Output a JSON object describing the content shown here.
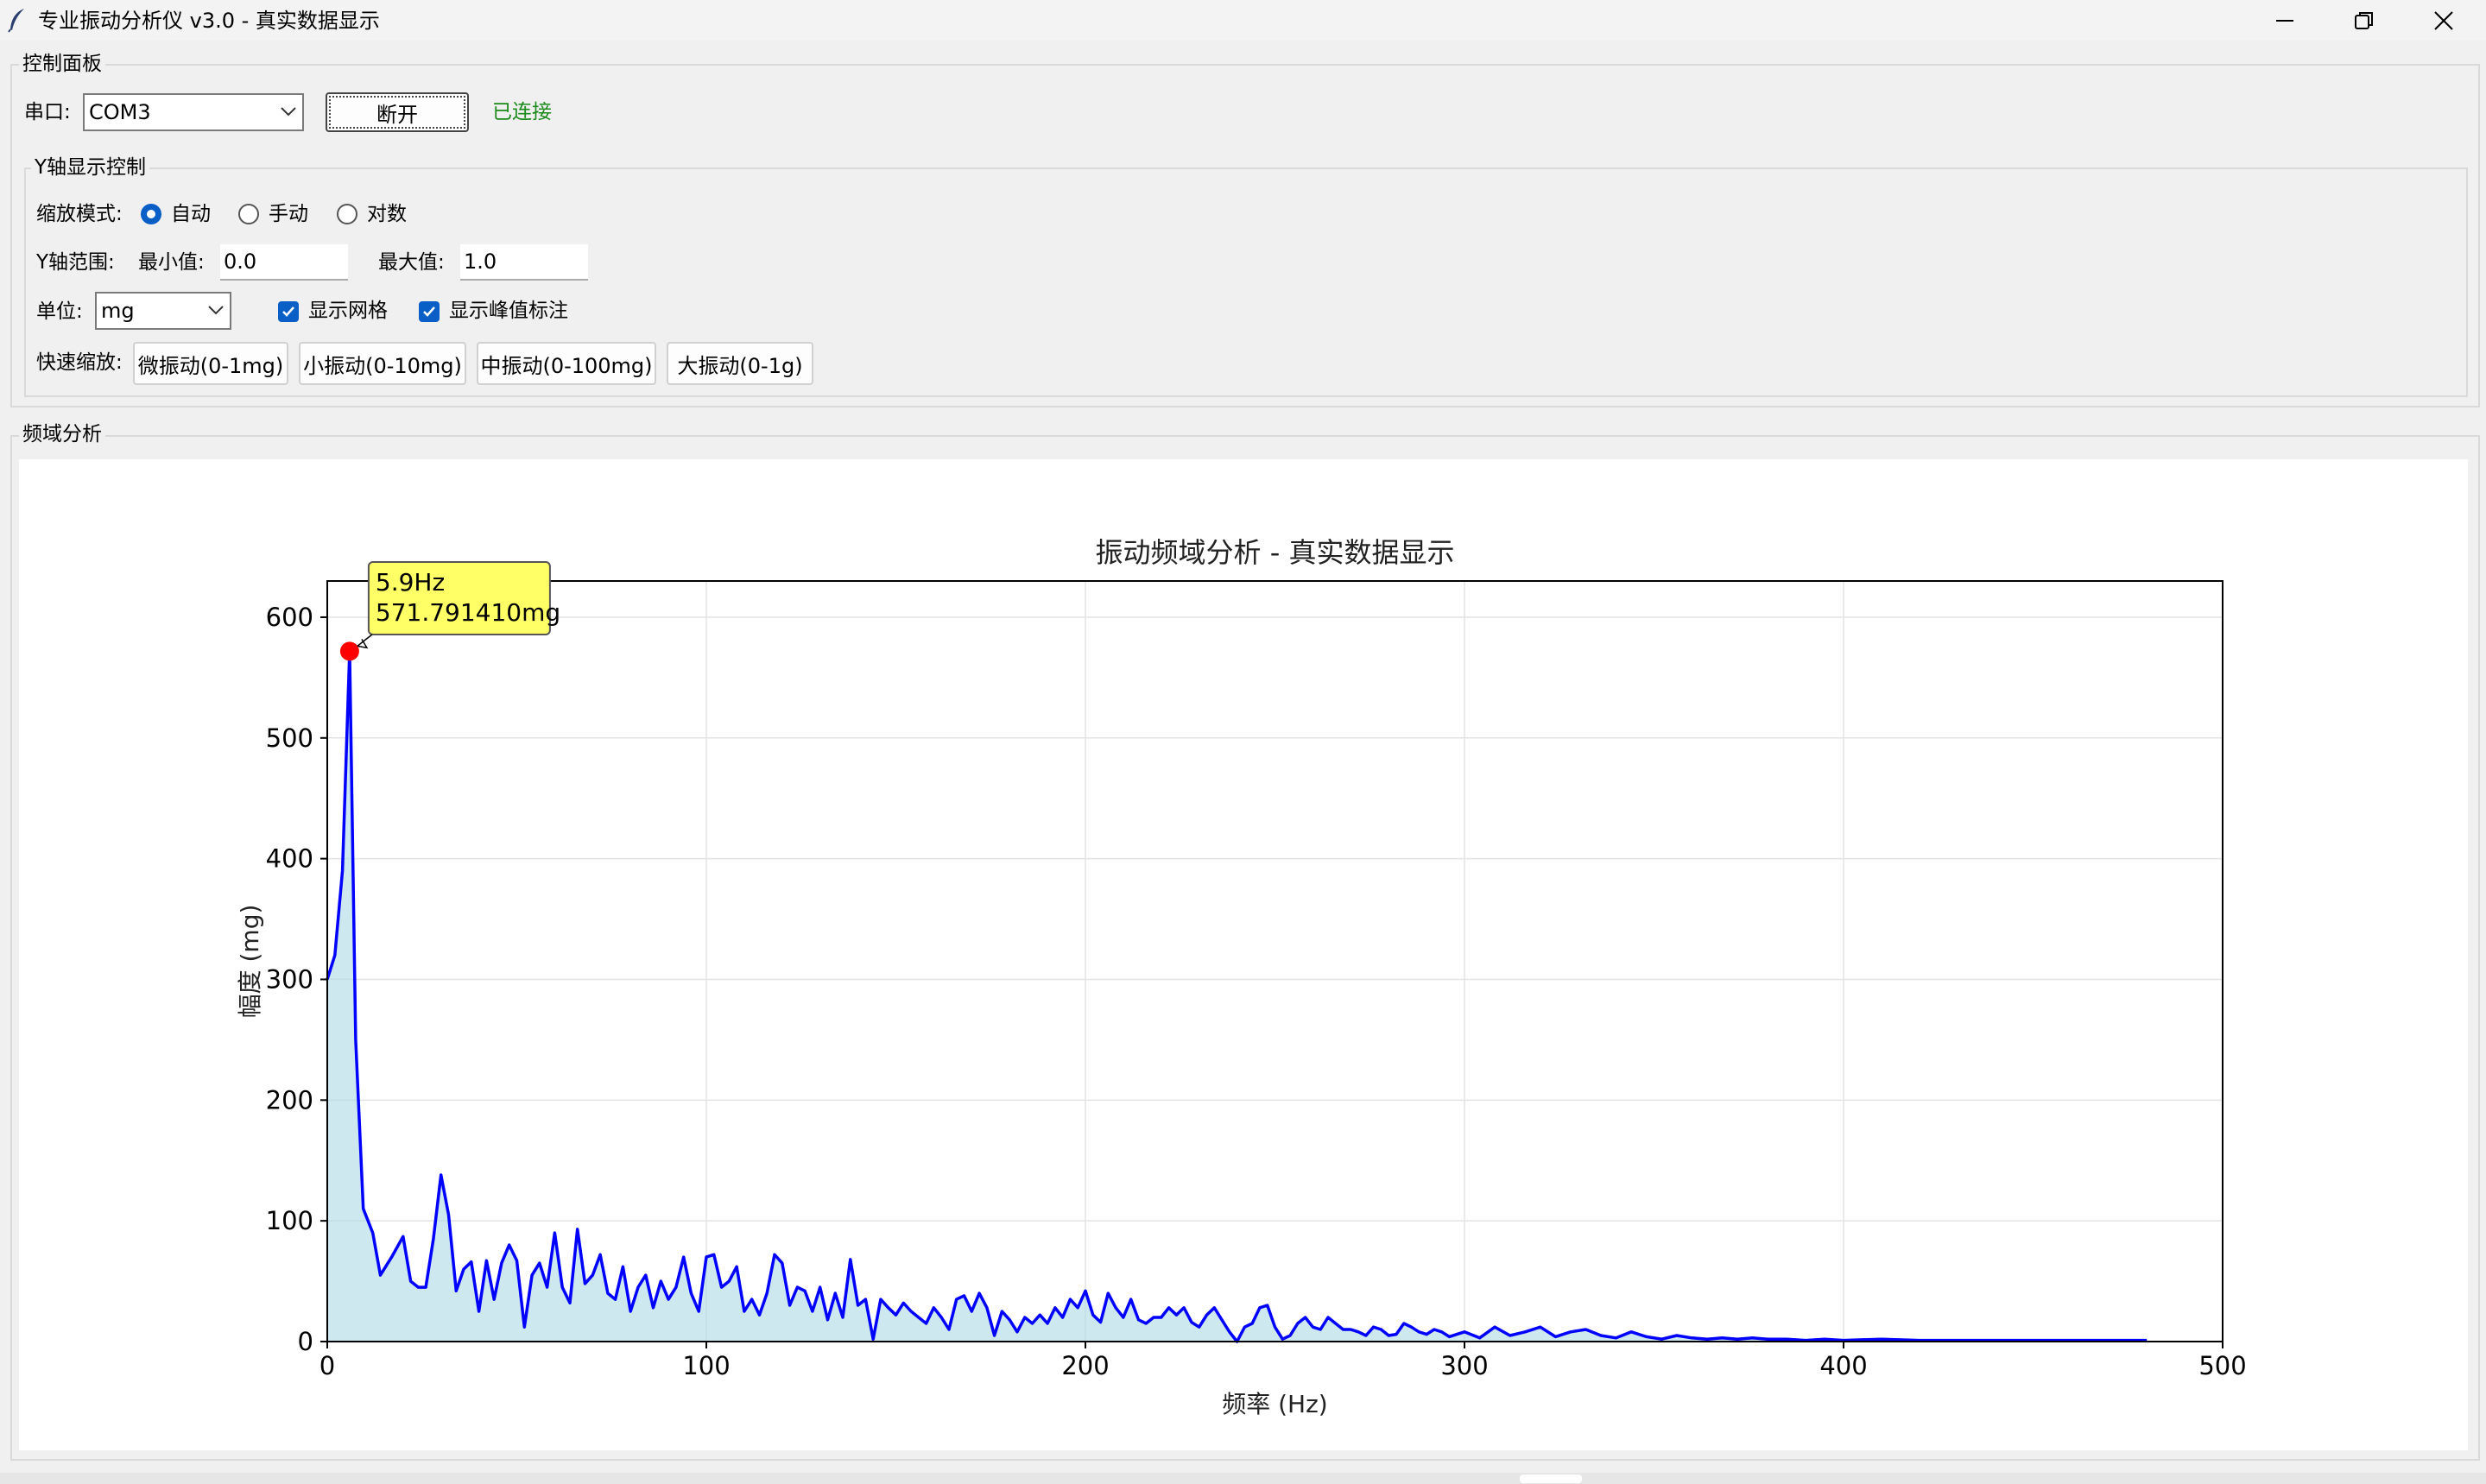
{
  "window": {
    "title": "专业振动分析仪 v3.0 - 真实数据显示",
    "minimize_icon": "minimize-icon",
    "restore_icon": "restore-icon",
    "close_icon": "close-icon"
  },
  "control_panel": {
    "title": "控制面板",
    "port_label": "串口:",
    "port_value": "COM3",
    "disconnect_label": "断开",
    "status_text": "已连接",
    "status_color": "#1a8a1a"
  },
  "y_axis_control": {
    "title": "Y轴显示控制",
    "scale_mode_label": "缩放模式:",
    "modes": [
      {
        "label": "自动",
        "selected": true
      },
      {
        "label": "手动",
        "selected": false
      },
      {
        "label": "对数",
        "selected": false
      }
    ],
    "range_label": "Y轴范围:",
    "min_label": "最小值:",
    "min_value": "0.0",
    "max_label": "最大值:",
    "max_value": "1.0",
    "unit_label": "单位:",
    "unit_value": "mg",
    "show_grid_label": "显示网格",
    "show_grid": true,
    "show_peak_label": "显示峰值标注",
    "show_peak": true,
    "quick_zoom_label": "快速缩放:",
    "quick_buttons": [
      "微振动(0-1mg)",
      "小振动(0-10mg)",
      "中振动(0-100mg)",
      "大振动(0-1g)"
    ]
  },
  "frequency_section": {
    "title": "频域分析"
  },
  "chart_data": {
    "type": "area",
    "title": "振动频域分析 - 真实数据显示",
    "xlabel": "频率 (Hz)",
    "ylabel": "幅度 (mg)",
    "xlim": [
      0,
      500
    ],
    "ylim": [
      0,
      630
    ],
    "xticks": [
      0,
      100,
      200,
      300,
      400,
      500
    ],
    "yticks": [
      0,
      100,
      200,
      300,
      400,
      500,
      600
    ],
    "grid": true,
    "line_color": "#0000ff",
    "fill_color": "#add8e6",
    "peak": {
      "x": 5.9,
      "y": 571.79141,
      "label_line1": "5.9Hz",
      "label_line2": "571.791410mg",
      "marker_color": "#ff0000",
      "box_color": "#ffff66"
    },
    "x": [
      0,
      2,
      4,
      5.9,
      7.5,
      9.5,
      12,
      14,
      17,
      20,
      22,
      24,
      26,
      28,
      30,
      32,
      34,
      36,
      38,
      40,
      42,
      44,
      46,
      48,
      50,
      52,
      54,
      56,
      58,
      60,
      62,
      64,
      66,
      68,
      70,
      72,
      74,
      76,
      78,
      80,
      82,
      84,
      86,
      88,
      90,
      92,
      94,
      96,
      98,
      100,
      102,
      104,
      106,
      108,
      110,
      112,
      114,
      116,
      118,
      120,
      122,
      124,
      126,
      128,
      130,
      132,
      134,
      136,
      138,
      140,
      142,
      144,
      146,
      148,
      150,
      152,
      154,
      156,
      158,
      160,
      162,
      164,
      166,
      168,
      170,
      172,
      174,
      176,
      178,
      180,
      182,
      184,
      186,
      188,
      190,
      192,
      194,
      196,
      198,
      200,
      202,
      204,
      206,
      208,
      210,
      212,
      214,
      216,
      218,
      220,
      222,
      224,
      226,
      228,
      230,
      232,
      234,
      236,
      238,
      240,
      242,
      244,
      246,
      248,
      250,
      252,
      254,
      256,
      258,
      260,
      262,
      264,
      266,
      268,
      270,
      272,
      274,
      276,
      278,
      280,
      282,
      284,
      286,
      288,
      290,
      292,
      294,
      296,
      298,
      300,
      304,
      308,
      312,
      316,
      320,
      324,
      328,
      332,
      336,
      340,
      344,
      348,
      352,
      356,
      360,
      364,
      368,
      372,
      376,
      380,
      385,
      390,
      395,
      400,
      410,
      420,
      430,
      440,
      450,
      460,
      470,
      480,
      490,
      500
    ],
    "y": [
      300,
      320,
      390,
      571.79,
      250,
      110,
      90,
      55,
      70,
      87,
      50,
      45,
      45,
      85,
      138,
      105,
      42,
      60,
      66,
      25,
      67,
      35,
      65,
      80,
      67,
      12,
      55,
      65,
      45,
      90,
      45,
      32,
      93,
      48,
      55,
      72,
      40,
      35,
      62,
      25,
      45,
      55,
      28,
      50,
      35,
      45,
      70,
      40,
      25,
      70,
      72,
      45,
      50,
      62,
      25,
      35,
      22,
      40,
      72,
      65,
      30,
      45,
      42,
      25,
      45,
      18,
      40,
      20,
      68,
      30,
      35,
      2,
      35,
      28,
      22,
      32,
      25,
      20,
      15,
      28,
      20,
      10,
      35,
      38,
      25,
      40,
      28,
      5,
      25,
      18,
      8,
      20,
      15,
      22,
      15,
      28,
      20,
      35,
      28,
      42,
      22,
      16,
      40,
      28,
      20,
      35,
      18,
      15,
      20,
      20,
      28,
      22,
      28,
      16,
      12,
      22,
      28,
      18,
      8,
      0,
      12,
      15,
      28,
      30,
      12,
      2,
      5,
      15,
      20,
      12,
      10,
      20,
      15,
      10,
      10,
      8,
      5,
      12,
      10,
      5,
      6,
      15,
      12,
      8,
      6,
      10,
      8,
      4,
      6,
      8,
      3,
      12,
      5,
      8,
      12,
      4,
      8,
      10,
      5,
      3,
      8,
      4,
      2,
      5,
      3,
      2,
      3,
      2,
      3,
      2,
      2,
      1,
      2,
      1,
      2,
      1,
      1,
      1,
      1,
      1,
      1,
      1
    ]
  }
}
